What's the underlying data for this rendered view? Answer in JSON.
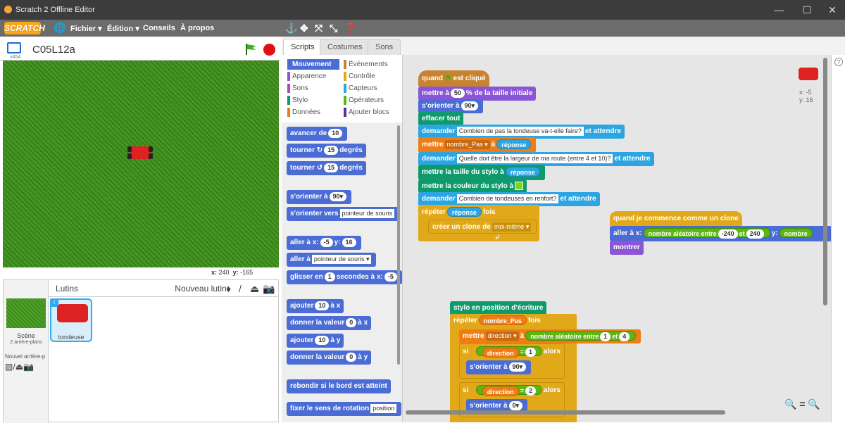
{
  "window": {
    "title": "Scratch 2 Offline Editor",
    "minimize": "—",
    "maximize": "☐",
    "close": "✕"
  },
  "menu": {
    "logo": "SCRATCH",
    "file": "Fichier ▾",
    "edit": "Édition ▾",
    "tips": "Conseils",
    "about": "À propos"
  },
  "stage": {
    "project_name": "C05L12a",
    "version": "v454",
    "x_label": "x:",
    "x_value": "240",
    "y_label": "y:",
    "y_value": "-165"
  },
  "sprites": {
    "header": "Lutins",
    "new_sprite": "Nouveau lutin:",
    "scene_label": "Scène",
    "scene_sub": "2 arrière-plans",
    "new_backdrop": "Nouvel arrière-p",
    "sprite_name": "tondeuse"
  },
  "tabs": [
    "Scripts",
    "Costumes",
    "Sons"
  ],
  "categories": [
    {
      "label": "Mouvement",
      "color": "#4a6cd4",
      "selected": true
    },
    {
      "label": "Événements",
      "color": "#c88330"
    },
    {
      "label": "Apparence",
      "color": "#8a55d7"
    },
    {
      "label": "Contrôle",
      "color": "#e1a91a"
    },
    {
      "label": "Sons",
      "color": "#bb42c3"
    },
    {
      "label": "Capteurs",
      "color": "#2ca5e2"
    },
    {
      "label": "Stylo",
      "color": "#0e9a6c"
    },
    {
      "label": "Opérateurs",
      "color": "#5cb712"
    },
    {
      "label": "Données",
      "color": "#ee7d16"
    },
    {
      "label": "Ajouter blocs",
      "color": "#632d99"
    }
  ],
  "palette": {
    "move": "avancer de",
    "move_n": "10",
    "turn_r": "tourner",
    "turn_r_icon": "↻",
    "turn_r_n": "15",
    "degrees": "degrés",
    "turn_l": "tourner",
    "turn_l_icon": "↺",
    "turn_l_n": "15",
    "point_dir": "s'orienter à",
    "point_dir_n": "90▾",
    "point_towards": "s'orienter vers",
    "point_towards_v": "pointeur de souris",
    "goto_xy": "aller à x:",
    "goto_x": "-5",
    "goto_y_label": "y:",
    "goto_y": "16",
    "goto": "aller à",
    "goto_v": "pointeur de souris ▾",
    "glide": "glisser en",
    "glide_n": "1",
    "glide_rest": "secondes à x:",
    "glide_x": "-5",
    "change_x": "ajouter",
    "change_x_n": "10",
    "change_x_rest": "à x",
    "set_x": "donner la valeur",
    "set_x_n": "0",
    "set_x_rest": "à x",
    "change_y": "ajouter",
    "change_y_n": "10",
    "change_y_rest": "à y",
    "set_y": "donner la valeur",
    "set_y_n": "0",
    "set_y_rest": "à y",
    "bounce": "rebondir si le bord est atteint",
    "rot_style": "fixer le sens de rotation",
    "rot_style_v": "position"
  },
  "script": {
    "hat": "quand",
    "hat_rest": "est cliqué",
    "size": "mettre à",
    "size_n": "50",
    "size_rest": "% de la taille initiale",
    "orient": "s'orienter à",
    "orient_n": "90▾",
    "clear": "effacer tout",
    "ask1": "demander",
    "ask1_q": "Combien de pas la tondeuse va-t-elle faire?",
    "ask_wait": "et attendre",
    "set_var": "mettre",
    "set_var_v": "nombre_Pas ▾",
    "set_var_to": "à",
    "answer": "réponse",
    "ask2_q": "Quelle doit être la largeur de ma route (entre 4 et 10)?",
    "pen_size": "mettre la taille du stylo à",
    "pen_color": "mettre la couleur du stylo à",
    "ask3_q": "Combien de tondeuses en renfort?",
    "repeat": "répéter",
    "repeat_rest": "fois",
    "clone": "créer un clone de",
    "clone_v": "moi-même ▾",
    "clone_hat": "quand je commence comme un clone",
    "goto_xy": "aller à x:",
    "rand": "nombre aléatoire entre",
    "rand_a": "-240",
    "and": "et",
    "rand_b": "240",
    "y_lbl": "y:",
    "rand_cut": "nombre",
    "show": "montrer",
    "pen_down": "stylo en position d'écriture",
    "repeat2_v": "nombre_Pas",
    "set_dir": "mettre",
    "set_dir_v": "direction ▾",
    "set_dir_to": "à",
    "rand2_a": "1",
    "rand2_b": "4",
    "if": "si",
    "dir_var": "direction",
    "eq": "=",
    "one": "1",
    "then": "alors",
    "orient2_n": "90▾",
    "two": "2",
    "orient3_n": "0▾"
  },
  "corner": {
    "x": "x: -5",
    "y": "y: 16"
  },
  "zoom": "🔍 = 🔍"
}
